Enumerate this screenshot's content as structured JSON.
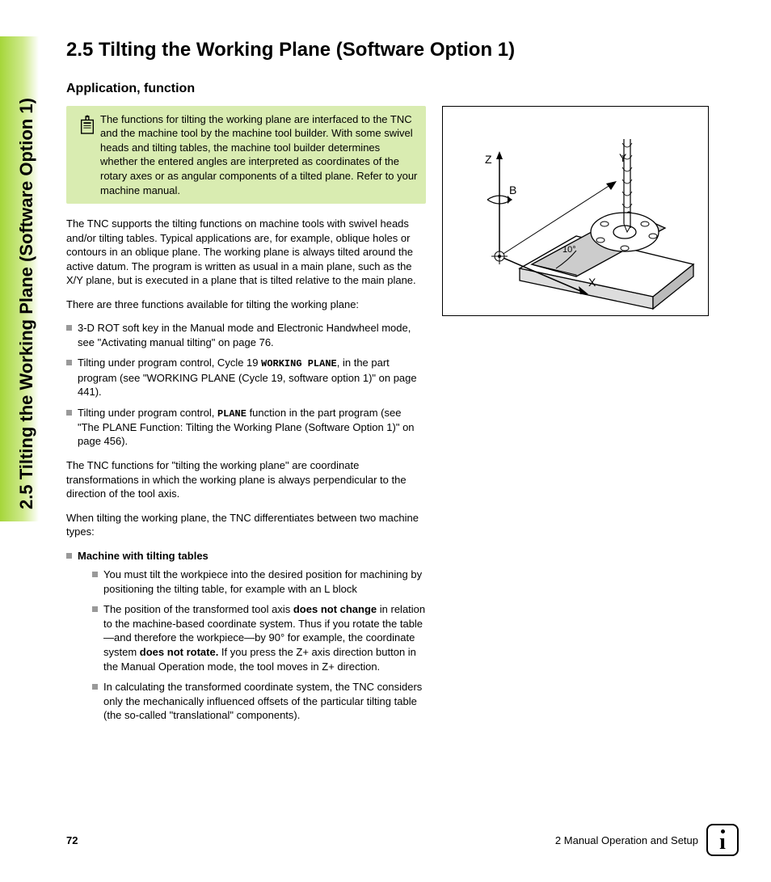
{
  "sidebar": "2.5 Tilting the Working Plane (Software Option 1)",
  "heading": {
    "num": "2.5",
    "title": "Tilting the Working Plane (Software Option 1)"
  },
  "subheading": "Application, function",
  "note": "The functions for tilting the working plane are interfaced to the TNC and the machine tool by the machine tool builder. With some swivel heads and tilting tables, the machine tool builder determines whether the entered angles are interpreted as coordinates of the rotary axes or as angular components of a tilted plane. Refer to your machine manual.",
  "p1": "The TNC supports the tilting functions on machine tools with swivel heads and/or tilting tables. Typical applications are, for example, oblique holes or contours in an oblique plane. The working plane is always tilted around the active datum. The program is written as usual in a main plane, such as the X/Y plane, but is executed in a plane that is tilted relative to the main plane.",
  "p2": "There are three functions available for tilting the working plane:",
  "list1": {
    "a": "3-D ROT soft key in the Manual mode and Electronic Handwheel mode, see \"Activating manual tilting\" on page 76.",
    "b_pre": "Tilting under program control, Cycle 19 ",
    "b_mono": "WORKING PLANE",
    "b_post": ", in the part program (see \"WORKING PLANE (Cycle 19, software option 1)\" on page 441).",
    "c_pre": "Tilting under program control, ",
    "c_mono": "PLANE",
    "c_post": " function in the part program (see \"The PLANE Function: Tilting the Working Plane (Software Option 1)\" on page 456)."
  },
  "p3": "The TNC functions for \"tilting the working plane\" are coordinate transformations in which the working plane is always perpendicular to the direction of the tool axis.",
  "p4": "When tilting the working plane, the TNC differentiates between two machine types:",
  "list2": {
    "head": "Machine with tilting tables",
    "a": "You must tilt the workpiece into the desired position for machining by positioning the tilting table, for example with an L block",
    "b_pre": "The position of the transformed tool axis ",
    "b_b1": "does not change",
    "b_mid": " in relation to the machine-based coordinate system. Thus if you rotate the table—and therefore the workpiece—by 90° for example, the coordinate system ",
    "b_b2": "does not rotate.",
    "b_post": "  If you press the Z+ axis direction button in the Manual Operation mode, the tool moves in Z+ direction.",
    "c": "In calculating the transformed coordinate system, the TNC considers only the mechanically influenced offsets of the particular tilting table (the so-called \"translational\" components)."
  },
  "figure": {
    "Z": "Z",
    "Y": "Y",
    "B": "B",
    "X": "X",
    "angle": "10°"
  },
  "footer": {
    "page": "72",
    "chapter": "2 Manual Operation and Setup"
  }
}
